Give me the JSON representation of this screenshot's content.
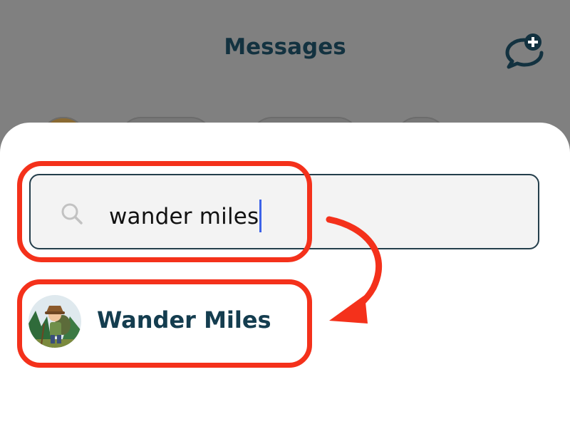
{
  "header": {
    "title": "Messages",
    "new_message_icon": "chat-bubble-plus-icon"
  },
  "search": {
    "value": "wander miles",
    "icon": "search-icon"
  },
  "results": [
    {
      "name": "Wander Miles",
      "avatar": "hiker-avatar"
    }
  ],
  "colors": {
    "title": "#133240",
    "accent_dark": "#143d4f",
    "annotation": "#f4311b",
    "caret": "#3d63e8",
    "overlay": "#808080"
  }
}
